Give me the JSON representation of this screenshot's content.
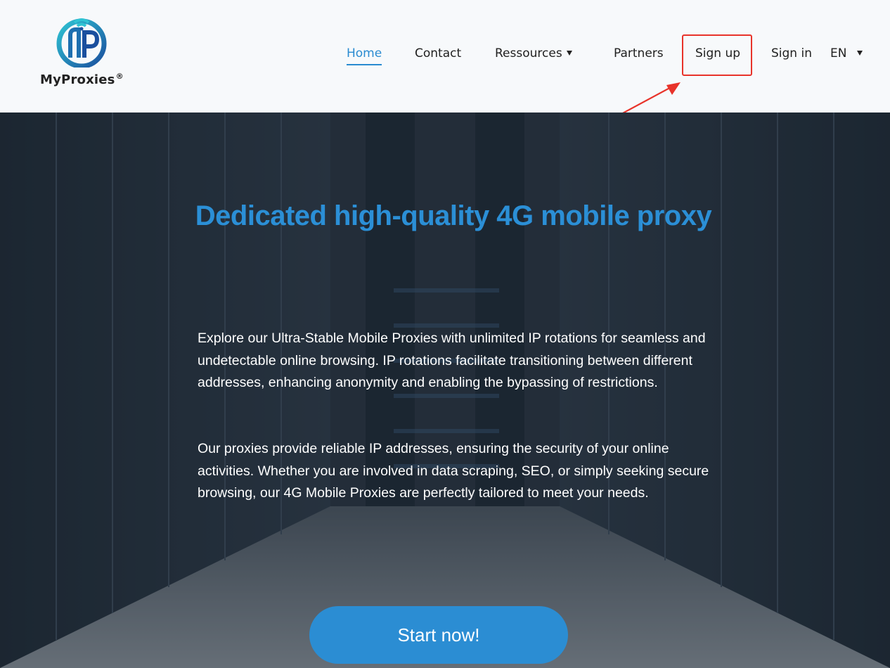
{
  "logo": {
    "brand": "MyProxies",
    "reg_mark": "®"
  },
  "nav": {
    "home": "Home",
    "contact": "Contact",
    "resources": "Ressources",
    "partners": "Partners",
    "sign_up": "Sign up",
    "sign_in": "Sign in",
    "language": "EN"
  },
  "hero": {
    "title": "Dedicated high-quality 4G mobile proxy",
    "paragraph1": "Explore our Ultra-Stable Mobile Proxies with unlimited IP rotations for seamless and undetectable online browsing. IP rotations facilitate transitioning between different addresses, enhancing anonymity and enabling the bypassing of restrictions.",
    "paragraph2": "Our proxies provide reliable IP addresses, ensuring the security of your online activities. Whether you are involved in data scraping, SEO, or simply seeking secure browsing, our 4G Mobile Proxies are perfectly tailored to meet your needs.",
    "cta": "Start now!"
  },
  "colors": {
    "accent": "#2b8fd6",
    "annotation_red": "#e8332a",
    "header_bg": "#f7f9fb"
  },
  "icons": {
    "logo": "myproxies-logo-icon",
    "dropdown": "caret-down-icon",
    "annotation": "red-arrow-icon"
  }
}
